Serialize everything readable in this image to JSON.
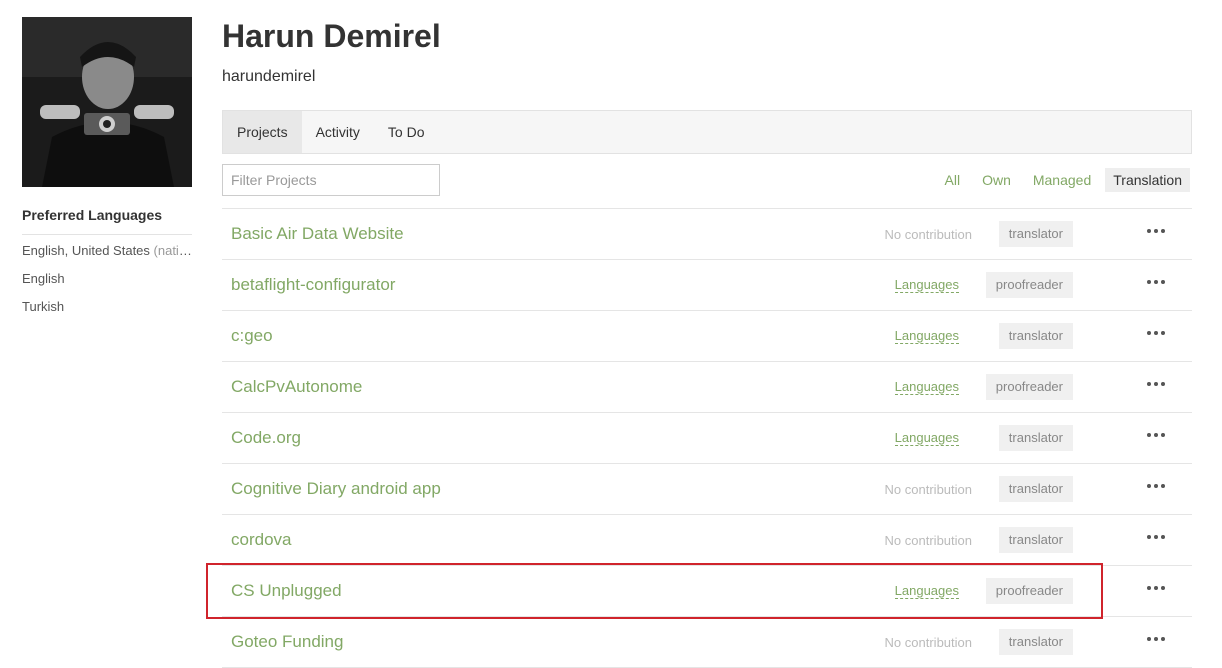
{
  "profile": {
    "name": "Harun Demirel",
    "username": "harundemirel",
    "avatar_icon": "profile-photo"
  },
  "preferred_languages": {
    "heading": "Preferred Languages",
    "items": [
      {
        "label": "English, United States",
        "note": "(native)"
      },
      {
        "label": "English",
        "note": ""
      },
      {
        "label": "Turkish",
        "note": ""
      }
    ]
  },
  "tabs": [
    {
      "label": "Projects",
      "active": true
    },
    {
      "label": "Activity",
      "active": false
    },
    {
      "label": "To Do",
      "active": false
    }
  ],
  "filter_input": {
    "placeholder": "Filter Projects",
    "value": ""
  },
  "filters": [
    {
      "label": "All",
      "active": false
    },
    {
      "label": "Own",
      "active": false
    },
    {
      "label": "Managed",
      "active": false
    },
    {
      "label": "Translation",
      "active": true
    }
  ],
  "projects": [
    {
      "name": "Basic Air Data Website",
      "status": "No contribution",
      "role": "translator"
    },
    {
      "name": "betaflight-configurator",
      "status": "Languages",
      "role": "proofreader"
    },
    {
      "name": "c:geo",
      "status": "Languages",
      "role": "translator"
    },
    {
      "name": "CalcPvAutonome",
      "status": "Languages",
      "role": "proofreader"
    },
    {
      "name": "Code.org",
      "status": "Languages",
      "role": "translator"
    },
    {
      "name": "Cognitive Diary android app",
      "status": "No contribution",
      "role": "translator"
    },
    {
      "name": "cordova",
      "status": "No contribution",
      "role": "translator"
    },
    {
      "name": "CS Unplugged",
      "status": "Languages",
      "role": "proofreader",
      "highlighted": true
    },
    {
      "name": "Goteo Funding",
      "status": "No contribution",
      "role": "translator"
    }
  ],
  "colors": {
    "link": "#82a865",
    "highlight": "#d0242c"
  }
}
